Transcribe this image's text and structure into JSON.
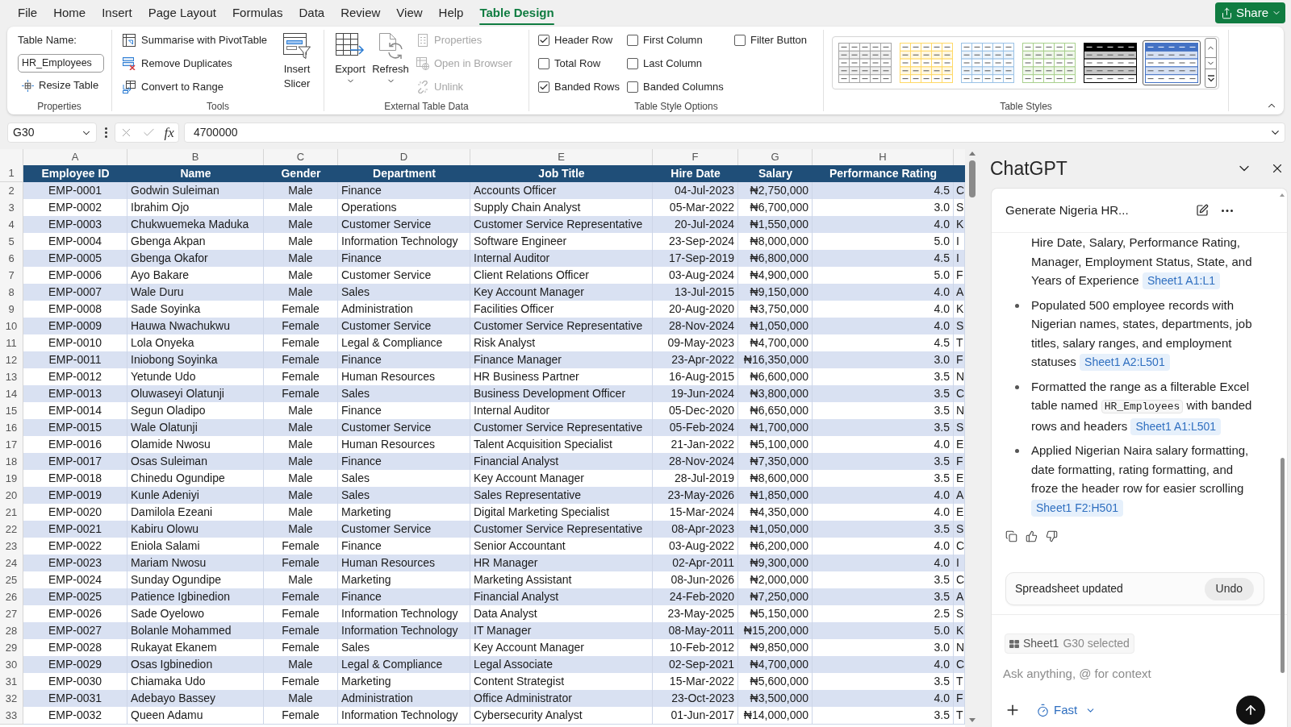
{
  "menu_tabs": [
    {
      "label": "File",
      "selected": false
    },
    {
      "label": "Home",
      "selected": false
    },
    {
      "label": "Insert",
      "selected": false
    },
    {
      "label": "Page Layout",
      "selected": false
    },
    {
      "label": "Formulas",
      "selected": false
    },
    {
      "label": "Data",
      "selected": false
    },
    {
      "label": "Review",
      "selected": false
    },
    {
      "label": "View",
      "selected": false
    },
    {
      "label": "Help",
      "selected": false
    },
    {
      "label": "Table Design",
      "selected": true
    }
  ],
  "share_button": "Share",
  "ribbon": {
    "properties": {
      "title": "Properties",
      "table_name_label": "Table Name:",
      "table_name_value": "HR_Employees",
      "resize_button": "Resize Table"
    },
    "tools": {
      "title": "Tools",
      "commands": [
        {
          "kind": "pivot",
          "label": "Summarise with PivotTable"
        },
        {
          "kind": "dedupe",
          "label": "Remove Duplicates"
        },
        {
          "kind": "convert",
          "label": "Convert to Range"
        }
      ],
      "slicer_button": "Insert Slicer"
    },
    "external_data": {
      "title": "External Table Data",
      "large_buttons": [
        {
          "kind": "export",
          "label": "Export"
        },
        {
          "kind": "refresh",
          "label": "Refresh"
        }
      ],
      "commands": [
        {
          "kind": "properties",
          "label": "Properties",
          "disabled": true
        },
        {
          "kind": "browser",
          "label": "Open in Browser",
          "disabled": true
        },
        {
          "kind": "unlink",
          "label": "Unlink",
          "disabled": true
        }
      ]
    },
    "style_options": {
      "title": "Table Style Options",
      "options": [
        {
          "label": "Header Row",
          "checked": true
        },
        {
          "label": "Total Row",
          "checked": false
        },
        {
          "label": "Banded Rows",
          "checked": true
        },
        {
          "label": "First Column",
          "checked": false
        },
        {
          "label": "Last Column",
          "checked": false
        },
        {
          "label": "Banded Columns",
          "checked": false
        },
        {
          "label": "Filter Button",
          "checked": false
        }
      ]
    },
    "table_styles": {
      "title": "Table Styles",
      "styles": [
        {
          "kind": "grid",
          "color": "#a6a6a6",
          "selected": false
        },
        {
          "kind": "grid",
          "color": "#ffd966",
          "selected": false
        },
        {
          "kind": "grid",
          "color": "#9bc2e6",
          "selected": false
        },
        {
          "kind": "grid",
          "color": "#a9d08e",
          "selected": false
        },
        {
          "kind": "banded",
          "color": "#000000",
          "selected": false
        },
        {
          "kind": "banded",
          "color": "#4472c4",
          "selected": true
        }
      ]
    }
  },
  "formula_bar": {
    "name_box": "G30",
    "function_label": "fx",
    "formula": "4700000"
  },
  "sheet": {
    "column_letters": [
      "A",
      "B",
      "C",
      "D",
      "E",
      "F",
      "G",
      "H"
    ],
    "header_row_number": "1",
    "headers": [
      "Employee ID",
      "Name",
      "Gender",
      "Department",
      "Job Title",
      "Hire Date",
      "Salary",
      "Performance Rating"
    ],
    "rows": [
      {
        "number": "2",
        "cells": [
          "EMP-0001",
          "Godwin Suleiman",
          "Male",
          "Finance",
          "Accounts Officer",
          "04-Jul-2023",
          "₦2,750,000",
          "4.5",
          "C"
        ]
      },
      {
        "number": "3",
        "cells": [
          "EMP-0002",
          "Ibrahim Ojo",
          "Male",
          "Operations",
          "Supply Chain Analyst",
          "05-Mar-2022",
          "₦6,700,000",
          "3.0",
          "S"
        ]
      },
      {
        "number": "4",
        "cells": [
          "EMP-0003",
          "Chukwuemeka Maduka",
          "Male",
          "Customer Service",
          "Customer Service Representative",
          "20-Jul-2024",
          "₦1,550,000",
          "4.0",
          "K"
        ]
      },
      {
        "number": "5",
        "cells": [
          "EMP-0004",
          "Gbenga Akpan",
          "Male",
          "Information Technology",
          "Software Engineer",
          "23-Sep-2024",
          "₦8,000,000",
          "5.0",
          "I"
        ]
      },
      {
        "number": "6",
        "cells": [
          "EMP-0005",
          "Gbenga Okafor",
          "Male",
          "Finance",
          "Internal Auditor",
          "17-Sep-2019",
          "₦6,800,000",
          "4.5",
          "I"
        ]
      },
      {
        "number": "7",
        "cells": [
          "EMP-0006",
          "Ayo Bakare",
          "Male",
          "Customer Service",
          "Client Relations Officer",
          "03-Aug-2024",
          "₦4,900,000",
          "5.0",
          "F"
        ]
      },
      {
        "number": "8",
        "cells": [
          "EMP-0007",
          "Wale Duru",
          "Male",
          "Sales",
          "Key Account Manager",
          "13-Jul-2015",
          "₦9,150,000",
          "4.0",
          "A"
        ]
      },
      {
        "number": "9",
        "cells": [
          "EMP-0008",
          "Sade Soyinka",
          "Female",
          "Administration",
          "Facilities Officer",
          "20-Aug-2020",
          "₦3,750,000",
          "4.0",
          "K"
        ]
      },
      {
        "number": "10",
        "cells": [
          "EMP-0009",
          "Hauwa Nwachukwu",
          "Female",
          "Customer Service",
          "Customer Service Representative",
          "28-Nov-2024",
          "₦1,050,000",
          "4.0",
          "S"
        ]
      },
      {
        "number": "11",
        "cells": [
          "EMP-0010",
          "Lola Onyeka",
          "Female",
          "Legal & Compliance",
          "Risk Analyst",
          "09-May-2023",
          "₦4,700,000",
          "4.5",
          "T"
        ]
      },
      {
        "number": "12",
        "cells": [
          "EMP-0011",
          "Iniobong Soyinka",
          "Female",
          "Finance",
          "Finance Manager",
          "23-Apr-2022",
          "₦16,350,000",
          "3.0",
          "F"
        ]
      },
      {
        "number": "13",
        "cells": [
          "EMP-0012",
          "Yetunde Udo",
          "Female",
          "Human Resources",
          "HR Business Partner",
          "16-Aug-2015",
          "₦6,600,000",
          "3.5",
          "N"
        ]
      },
      {
        "number": "14",
        "cells": [
          "EMP-0013",
          "Oluwaseyi Olatunji",
          "Female",
          "Sales",
          "Business Development Officer",
          "19-Jun-2024",
          "₦3,800,000",
          "3.5",
          "C"
        ]
      },
      {
        "number": "15",
        "cells": [
          "EMP-0014",
          "Segun Oladipo",
          "Male",
          "Finance",
          "Internal Auditor",
          "05-Dec-2020",
          "₦6,650,000",
          "3.5",
          "N"
        ]
      },
      {
        "number": "16",
        "cells": [
          "EMP-0015",
          "Wale Olatunji",
          "Male",
          "Customer Service",
          "Customer Service Representative",
          "05-Feb-2024",
          "₦1,700,000",
          "3.5",
          "S"
        ]
      },
      {
        "number": "17",
        "cells": [
          "EMP-0016",
          "Olamide Nwosu",
          "Male",
          "Human Resources",
          "Talent Acquisition Specialist",
          "21-Jan-2022",
          "₦5,100,000",
          "4.0",
          "E"
        ]
      },
      {
        "number": "18",
        "cells": [
          "EMP-0017",
          "Osas Suleiman",
          "Male",
          "Finance",
          "Financial Analyst",
          "28-Nov-2024",
          "₦7,350,000",
          "3.5",
          "F"
        ]
      },
      {
        "number": "19",
        "cells": [
          "EMP-0018",
          "Chinedu Ogundipe",
          "Male",
          "Sales",
          "Key Account Manager",
          "28-Jul-2019",
          "₦8,600,000",
          "3.5",
          "E"
        ]
      },
      {
        "number": "20",
        "cells": [
          "EMP-0019",
          "Kunle Adeniyi",
          "Male",
          "Sales",
          "Sales Representative",
          "23-May-2026",
          "₦1,850,000",
          "4.0",
          "A"
        ]
      },
      {
        "number": "21",
        "cells": [
          "EMP-0020",
          "Damilola Ezeani",
          "Male",
          "Marketing",
          "Digital Marketing Specialist",
          "15-Mar-2024",
          "₦4,350,000",
          "4.0",
          "E"
        ]
      },
      {
        "number": "22",
        "cells": [
          "EMP-0021",
          "Kabiru Olowu",
          "Male",
          "Customer Service",
          "Customer Service Representative",
          "08-Apr-2023",
          "₦1,050,000",
          "3.5",
          "S"
        ]
      },
      {
        "number": "23",
        "cells": [
          "EMP-0022",
          "Eniola Salami",
          "Female",
          "Finance",
          "Senior Accountant",
          "03-Aug-2022",
          "₦6,200,000",
          "4.0",
          "C"
        ]
      },
      {
        "number": "24",
        "cells": [
          "EMP-0023",
          "Mariam Nwosu",
          "Female",
          "Human Resources",
          "HR Manager",
          "02-Apr-2011",
          "₦9,300,000",
          "4.0",
          "I"
        ]
      },
      {
        "number": "25",
        "cells": [
          "EMP-0024",
          "Sunday Ogundipe",
          "Male",
          "Marketing",
          "Marketing Assistant",
          "08-Jun-2026",
          "₦2,000,000",
          "3.5",
          "C"
        ]
      },
      {
        "number": "26",
        "cells": [
          "EMP-0025",
          "Patience Igbinedion",
          "Female",
          "Finance",
          "Financial Analyst",
          "24-Feb-2020",
          "₦7,250,000",
          "3.5",
          "A"
        ]
      },
      {
        "number": "27",
        "cells": [
          "EMP-0026",
          "Sade Oyelowo",
          "Female",
          "Information Technology",
          "Data Analyst",
          "23-May-2025",
          "₦5,150,000",
          "2.5",
          "S"
        ]
      },
      {
        "number": "28",
        "cells": [
          "EMP-0027",
          "Bolanle Mohammed",
          "Female",
          "Information Technology",
          "IT Manager",
          "08-May-2011",
          "₦15,200,000",
          "5.0",
          "K"
        ]
      },
      {
        "number": "29",
        "cells": [
          "EMP-0028",
          "Rukayat Ekanem",
          "Female",
          "Sales",
          "Key Account Manager",
          "10-Feb-2012",
          "₦9,850,000",
          "3.0",
          "N"
        ]
      },
      {
        "number": "30",
        "cells": [
          "EMP-0029",
          "Osas Igbinedion",
          "Male",
          "Legal & Compliance",
          "Legal Associate",
          "02-Sep-2021",
          "₦4,700,000",
          "4.0",
          "C"
        ]
      },
      {
        "number": "31",
        "cells": [
          "EMP-0030",
          "Chiamaka Udo",
          "Female",
          "Marketing",
          "Content Strategist",
          "15-Mar-2022",
          "₦5,600,000",
          "3.5",
          "T"
        ]
      },
      {
        "number": "32",
        "cells": [
          "EMP-0031",
          "Adebayo Bassey",
          "Male",
          "Administration",
          "Office Administrator",
          "23-Oct-2023",
          "₦3,500,000",
          "4.0",
          "F"
        ]
      },
      {
        "number": "33",
        "cells": [
          "EMP-0032",
          "Queen Adamu",
          "Female",
          "Information Technology",
          "Cybersecurity Analyst",
          "01-Jun-2017",
          "₦14,000,000",
          "3.5",
          "T"
        ]
      }
    ]
  },
  "assistant_panel": {
    "title": "ChatGPT",
    "conversation_title": "Generate Nigeria HR...",
    "message_items": [
      {
        "bullet": false,
        "text": "Hire Date, Salary, Performance Rating, Manager, Employment Status, State, and Years of Experience",
        "reference": "Sheet1 A1:L1"
      },
      {
        "bullet": true,
        "text": "Populated 500 employee records with Nigerian names, states, departments, job titles, salary ranges, and employment statuses",
        "reference": "Sheet1 A2:L501"
      },
      {
        "bullet": true,
        "text": "Formatted the range as a filterable Excel table named",
        "code": "HR_Employees",
        "text_after": "with banded rows and headers",
        "reference": "Sheet1 A1:L501"
      },
      {
        "bullet": true,
        "text": "Applied Nigerian Naira salary formatting, date formatting, rating formatting, and froze the header row for easier scrolling",
        "reference": "Sheet1 F2:H501"
      }
    ],
    "status_text": "Spreadsheet updated",
    "undo_button": "Undo",
    "context_chip": {
      "sheet": "Sheet1",
      "selection": "G30 selected"
    },
    "input_placeholder": "Ask anything, @ for context",
    "mode_button": "Fast"
  }
}
